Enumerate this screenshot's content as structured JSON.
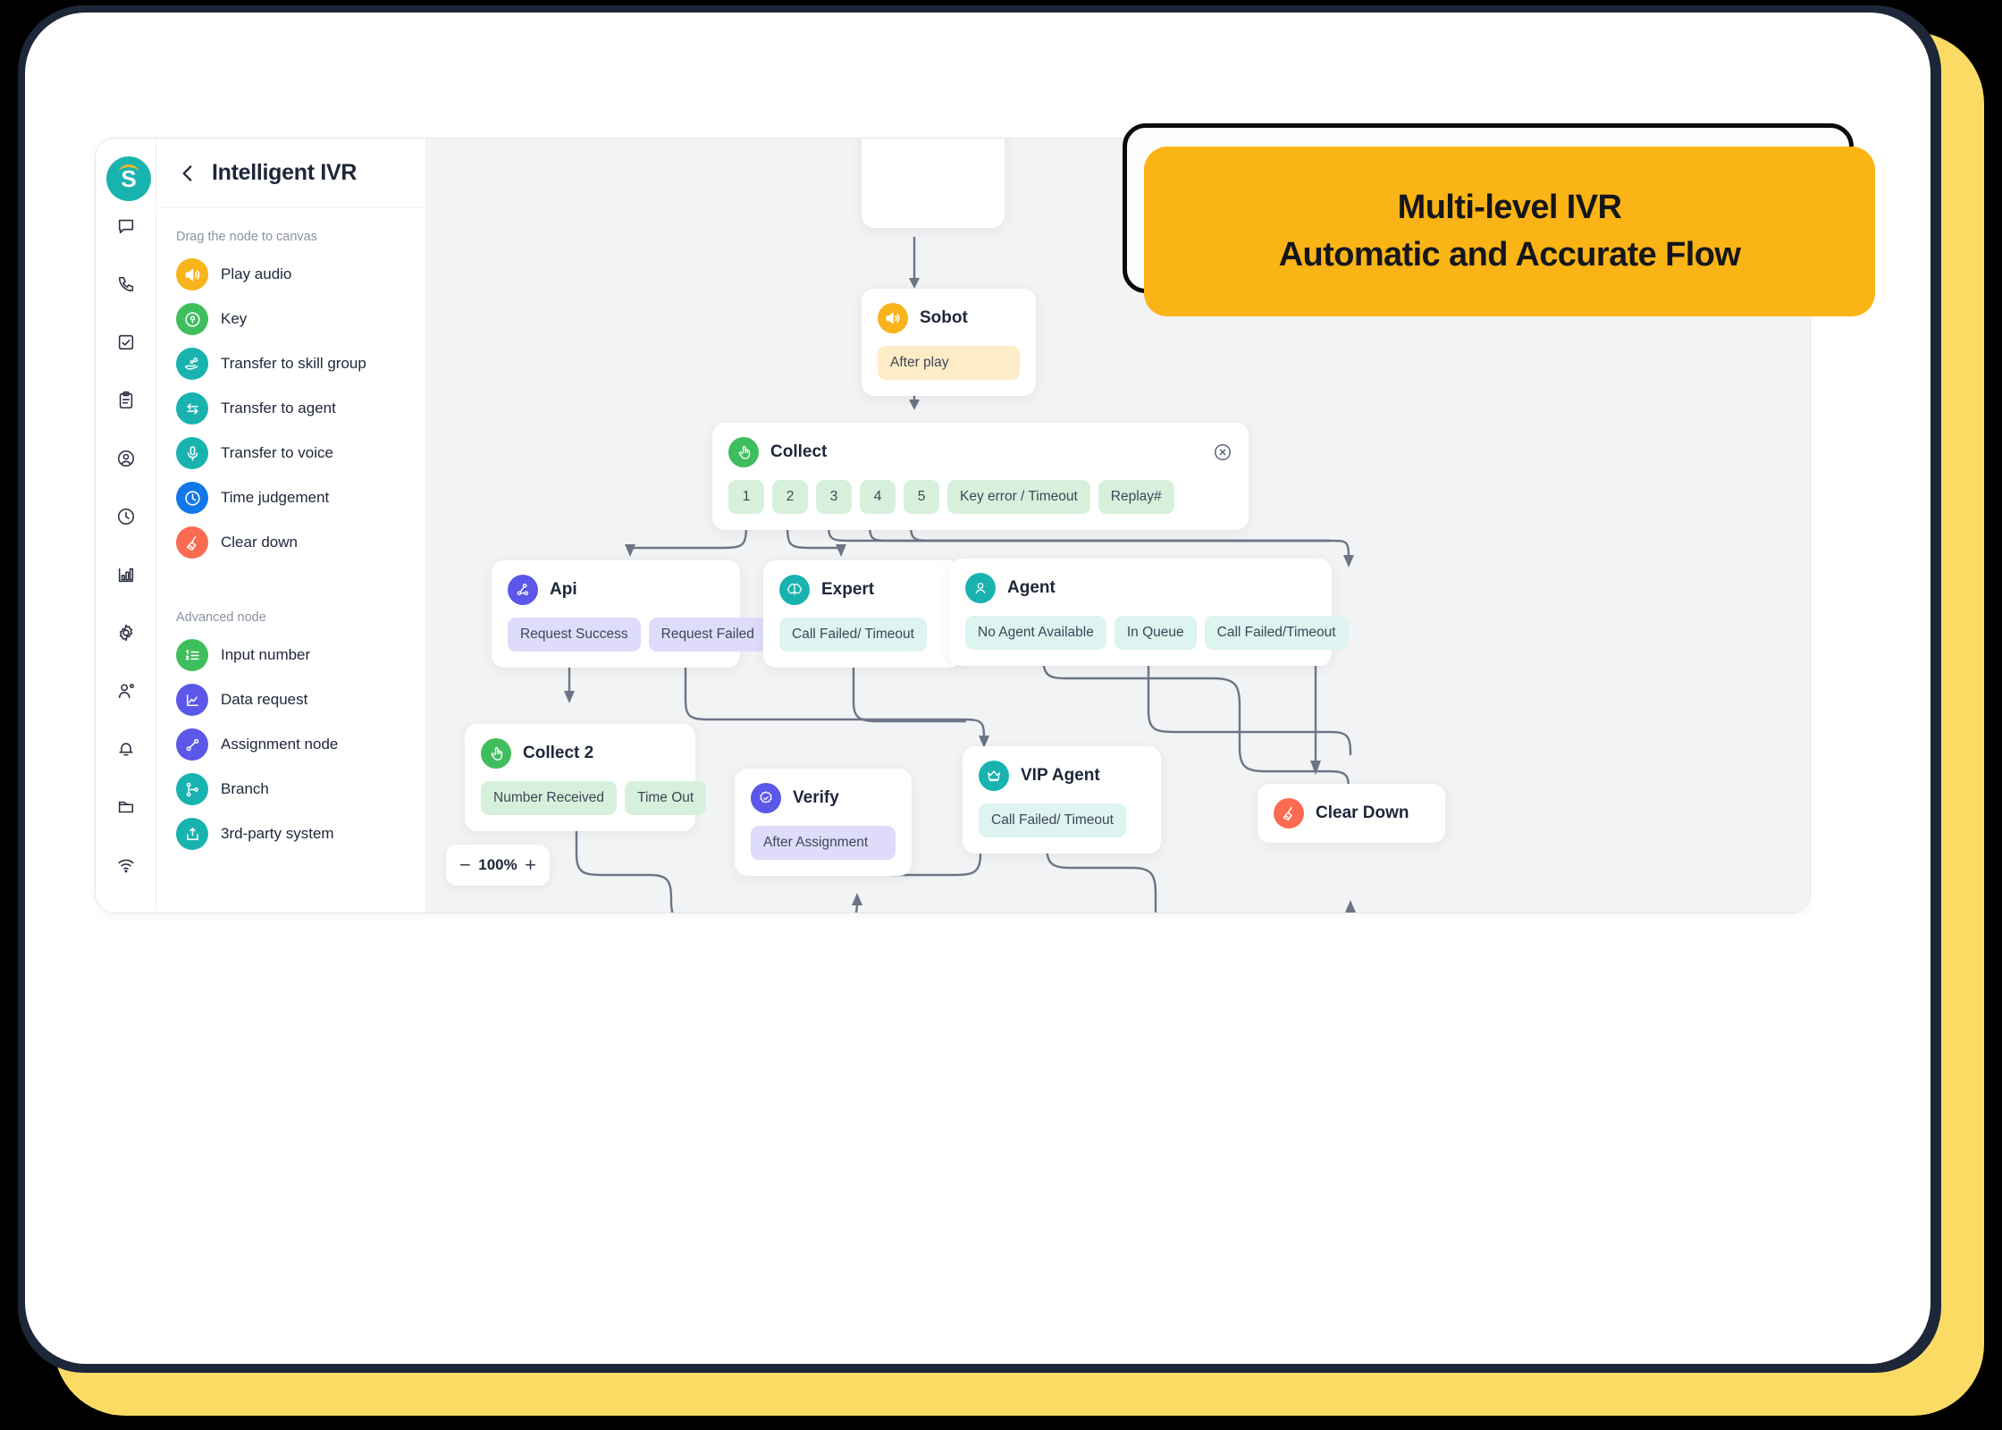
{
  "header": {
    "title": "Intelligent IVR",
    "back_icon": "chevron-left-icon",
    "logo_letter": "S"
  },
  "rail": {
    "items": [
      {
        "icon": "chat-bubble-icon",
        "name": "rail-item-chat"
      },
      {
        "icon": "phone-icon",
        "name": "rail-item-calls"
      },
      {
        "icon": "checkbox-icon",
        "name": "rail-item-tasks"
      },
      {
        "icon": "clipboard-icon",
        "name": "rail-item-clipboard"
      },
      {
        "icon": "user-circle-icon",
        "name": "rail-item-contacts"
      },
      {
        "icon": "clock-icon",
        "name": "rail-item-history"
      },
      {
        "icon": "bar-chart-icon",
        "name": "rail-item-analytics"
      },
      {
        "icon": "gear-icon",
        "name": "rail-item-settings"
      },
      {
        "icon": "user-settings-icon",
        "name": "rail-item-user-settings"
      },
      {
        "icon": "bell-icon",
        "name": "rail-item-notifications"
      },
      {
        "icon": "folder-icon",
        "name": "rail-item-files"
      },
      {
        "icon": "wifi-icon",
        "name": "rail-item-network"
      }
    ]
  },
  "palette": {
    "basic_label": "Drag the node to canvas",
    "advanced_label": "Advanced node",
    "basic_nodes": [
      {
        "label": "Play audio",
        "icon": "speaker-icon",
        "color": "#F9B31B"
      },
      {
        "label": "Key",
        "icon": "keypad-lock-icon",
        "color": "#3FBE5E"
      },
      {
        "label": "Transfer to skill group",
        "icon": "hand-group-icon",
        "color": "#19B3AF"
      },
      {
        "label": "Transfer to agent",
        "icon": "transfer-arrows-icon",
        "color": "#19B3AF"
      },
      {
        "label": "Transfer to voice",
        "icon": "microphone-icon",
        "color": "#19B3AF"
      },
      {
        "label": "Time judgement",
        "icon": "clock-icon",
        "color": "#1277E8"
      },
      {
        "label": "Clear down",
        "icon": "broom-icon",
        "color": "#FA6B51"
      }
    ],
    "advanced_nodes": [
      {
        "label": "Input number",
        "icon": "numbered-list-icon",
        "color": "#3FBE5E"
      },
      {
        "label": "Data request",
        "icon": "line-chart-icon",
        "color": "#5B57E8"
      },
      {
        "label": "Assignment node",
        "icon": "node-link-icon",
        "color": "#5B57E8"
      },
      {
        "label": "Branch",
        "icon": "branch-icon",
        "color": "#19B3AF"
      },
      {
        "label": "3rd-party system",
        "icon": "upload-box-icon",
        "color": "#19B3AF"
      }
    ]
  },
  "canvas": {
    "zoom": {
      "level": "100%",
      "minus": "−",
      "plus": "+"
    },
    "nodes": [
      {
        "id": "sobot",
        "title": "Sobot",
        "icon": "speaker-icon",
        "icon_color": "#F9B31B",
        "ports": [
          {
            "label": "After play",
            "style": "chip-amber"
          }
        ],
        "has_close": false
      },
      {
        "id": "collect",
        "title": "Collect",
        "icon": "hand-press-icon",
        "icon_color": "#3FBE5E",
        "ports": [
          {
            "label": "1",
            "style": "chip-green"
          },
          {
            "label": "2",
            "style": "chip-green"
          },
          {
            "label": "3",
            "style": "chip-green"
          },
          {
            "label": "4",
            "style": "chip-green"
          },
          {
            "label": "5",
            "style": "chip-green"
          },
          {
            "label": "Key error / Timeout",
            "style": "chip-green"
          },
          {
            "label": "Replay#",
            "style": "chip-green"
          }
        ],
        "has_close": true
      },
      {
        "id": "api",
        "title": "Api",
        "icon": "api-icon",
        "icon_color": "#5B57E8",
        "ports": [
          {
            "label": "Request Success",
            "style": "chip-purple"
          },
          {
            "label": "Request Failed",
            "style": "chip-purple"
          }
        ],
        "has_close": false
      },
      {
        "id": "expert",
        "title": "Expert",
        "icon": "brain-icon",
        "icon_color": "#19B3AF",
        "ports": [
          {
            "label": "Call Failed/ Timeout",
            "style": "chip-mint"
          }
        ],
        "has_close": false
      },
      {
        "id": "agent",
        "title": "Agent",
        "icon": "user-icon",
        "icon_color": "#19B3AF",
        "ports": [
          {
            "label": "No Agent Available",
            "style": "chip-mint"
          },
          {
            "label": "In Queue",
            "style": "chip-mint"
          },
          {
            "label": "Call Failed/Timeout",
            "style": "chip-mint"
          }
        ],
        "has_close": false
      },
      {
        "id": "collect2",
        "title": "Collect 2",
        "icon": "hand-press-icon",
        "icon_color": "#3FBE5E",
        "ports": [
          {
            "label": "Number Received",
            "style": "chip-green"
          },
          {
            "label": "Time Out",
            "style": "chip-green"
          }
        ],
        "has_close": false
      },
      {
        "id": "verify",
        "title": "Verify",
        "icon": "verified-badge-icon",
        "icon_color": "#5B57E8",
        "ports": [
          {
            "label": "After Assignment",
            "style": "chip-purple"
          }
        ],
        "has_close": false
      },
      {
        "id": "vip-agent",
        "title": "VIP Agent",
        "icon": "crown-icon",
        "icon_color": "#19B3AF",
        "ports": [
          {
            "label": "Call Failed/ Timeout",
            "style": "chip-mint"
          }
        ],
        "has_close": false
      },
      {
        "id": "clear-down",
        "title": "Clear Down",
        "icon": "broom-icon",
        "icon_color": "#FA6B51",
        "ports": [],
        "has_close": false
      }
    ]
  },
  "callout": {
    "line1": "Multi-level IVR",
    "line2": "Automatic and Accurate Flow",
    "fill_color": "#FBB415",
    "outline_color": "#0B0B0C"
  },
  "theme": {
    "brand_teal": "#19B3AF",
    "accent_yellow": "#FBDB64",
    "shell_navy": "#1E2639",
    "canvas_bg": "#F2F3F4",
    "wire_color": "#6C7487"
  }
}
